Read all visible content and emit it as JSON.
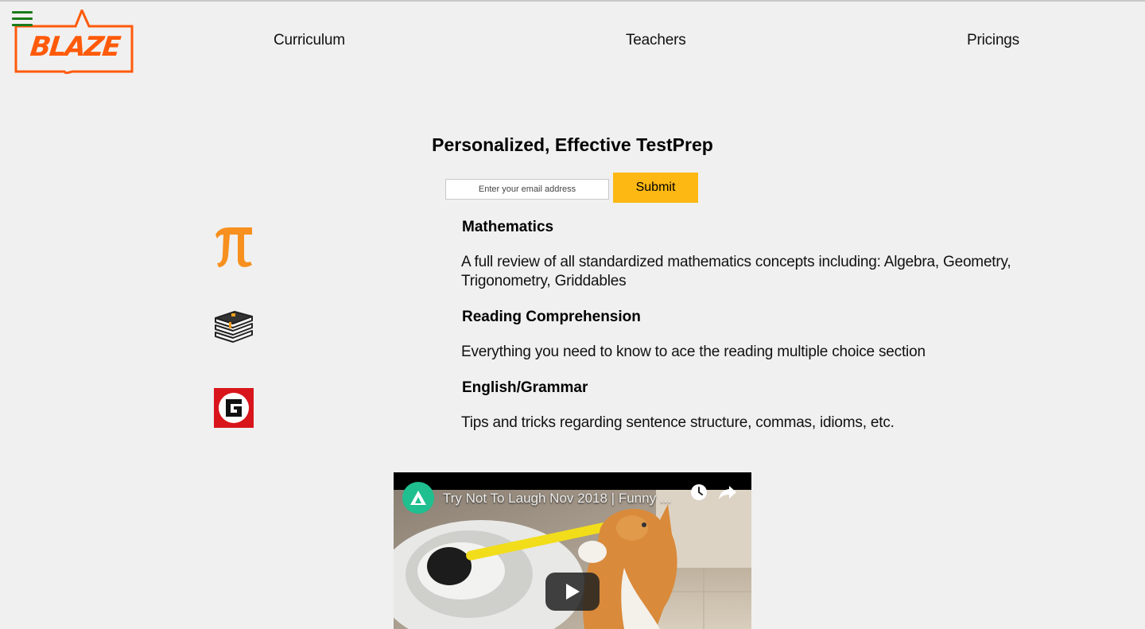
{
  "header": {
    "logo_text": "BLAZE",
    "brand_color": "#ff5a0a",
    "menu_icon": "hamburger-icon",
    "menu_icon_color": "#1a7a1a",
    "nav": [
      {
        "label": "Curriculum"
      },
      {
        "label": "Teachers"
      },
      {
        "label": "Pricings"
      }
    ]
  },
  "hero": {
    "title": "Personalized, Effective TestPrep",
    "email_placeholder": "Enter your email address",
    "submit_label": "Submit",
    "submit_color": "#fdb813"
  },
  "subjects": [
    {
      "icon": "pi-icon",
      "title": "Mathematics",
      "description": "A full review of all standardized mathematics concepts including: Algebra, Geometry, Trigonometry, Griddables"
    },
    {
      "icon": "books-icon",
      "title": "Reading Comprehension",
      "description": "Everything you need to know to ace the reading multiple choice section"
    },
    {
      "icon": "grammar-g-icon",
      "title": "English/Grammar",
      "description": "Tips and tricks regarding sentence structure, commas, idioms, etc."
    }
  ],
  "video": {
    "title": "Try Not To Laugh Nov 2018 | Funny ...",
    "icons": [
      "channel-avatar-icon",
      "watch-later-icon",
      "share-icon",
      "play-button-icon"
    ]
  }
}
